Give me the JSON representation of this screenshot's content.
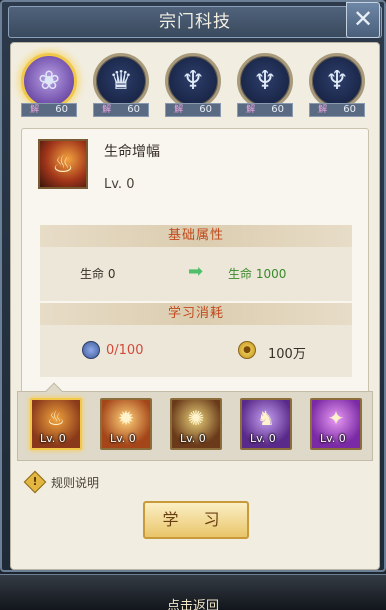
{
  "window": {
    "title": "宗门科技",
    "close_glyph": "✕"
  },
  "tech_tabs": [
    {
      "icon": "rabbit-beast-icon",
      "glyph": "❀",
      "level": "60",
      "lock": "解",
      "active": true
    },
    {
      "icon": "tiger-beast-icon",
      "glyph": "♛",
      "level": "60",
      "lock": "解",
      "active": false
    },
    {
      "icon": "dragon-beast-icon",
      "glyph": "♆",
      "level": "60",
      "lock": "解",
      "active": false
    },
    {
      "icon": "dragon-beast-icon",
      "glyph": "♆",
      "level": "60",
      "lock": "解",
      "active": false
    },
    {
      "icon": "dragon-beast-icon",
      "glyph": "♆",
      "level": "60",
      "lock": "解",
      "active": false
    }
  ],
  "skill_detail": {
    "name": "生命增幅",
    "level": "Lv. 0",
    "attr_section": "基础属性",
    "attr_current": "生命  0",
    "attr_next": "生命  1000",
    "cost_section": "学习消耗",
    "cost_token": "0/100",
    "cost_gold": "100万"
  },
  "skills": [
    {
      "icon": "life-boost-icon",
      "glyph": "♨",
      "level": "Lv. 0",
      "active": true,
      "bg": "#8a3a1a"
    },
    {
      "icon": "flame-burst-icon",
      "glyph": "✹",
      "level": "Lv. 0",
      "active": false,
      "bg": "#a4461a"
    },
    {
      "icon": "spirit-orb-icon",
      "glyph": "✺",
      "level": "Lv. 0",
      "active": false,
      "bg": "#6a3a1a"
    },
    {
      "icon": "shadow-warrior-icon",
      "glyph": "♞",
      "level": "Lv. 0",
      "active": false,
      "bg": "#5a2a8a"
    },
    {
      "icon": "purple-vortex-icon",
      "glyph": "✦",
      "level": "Lv. 0",
      "active": false,
      "bg": "#7a2aa4"
    }
  ],
  "rules_label": "规则说明",
  "learn_button": "学 习",
  "return_label": "点击返回"
}
